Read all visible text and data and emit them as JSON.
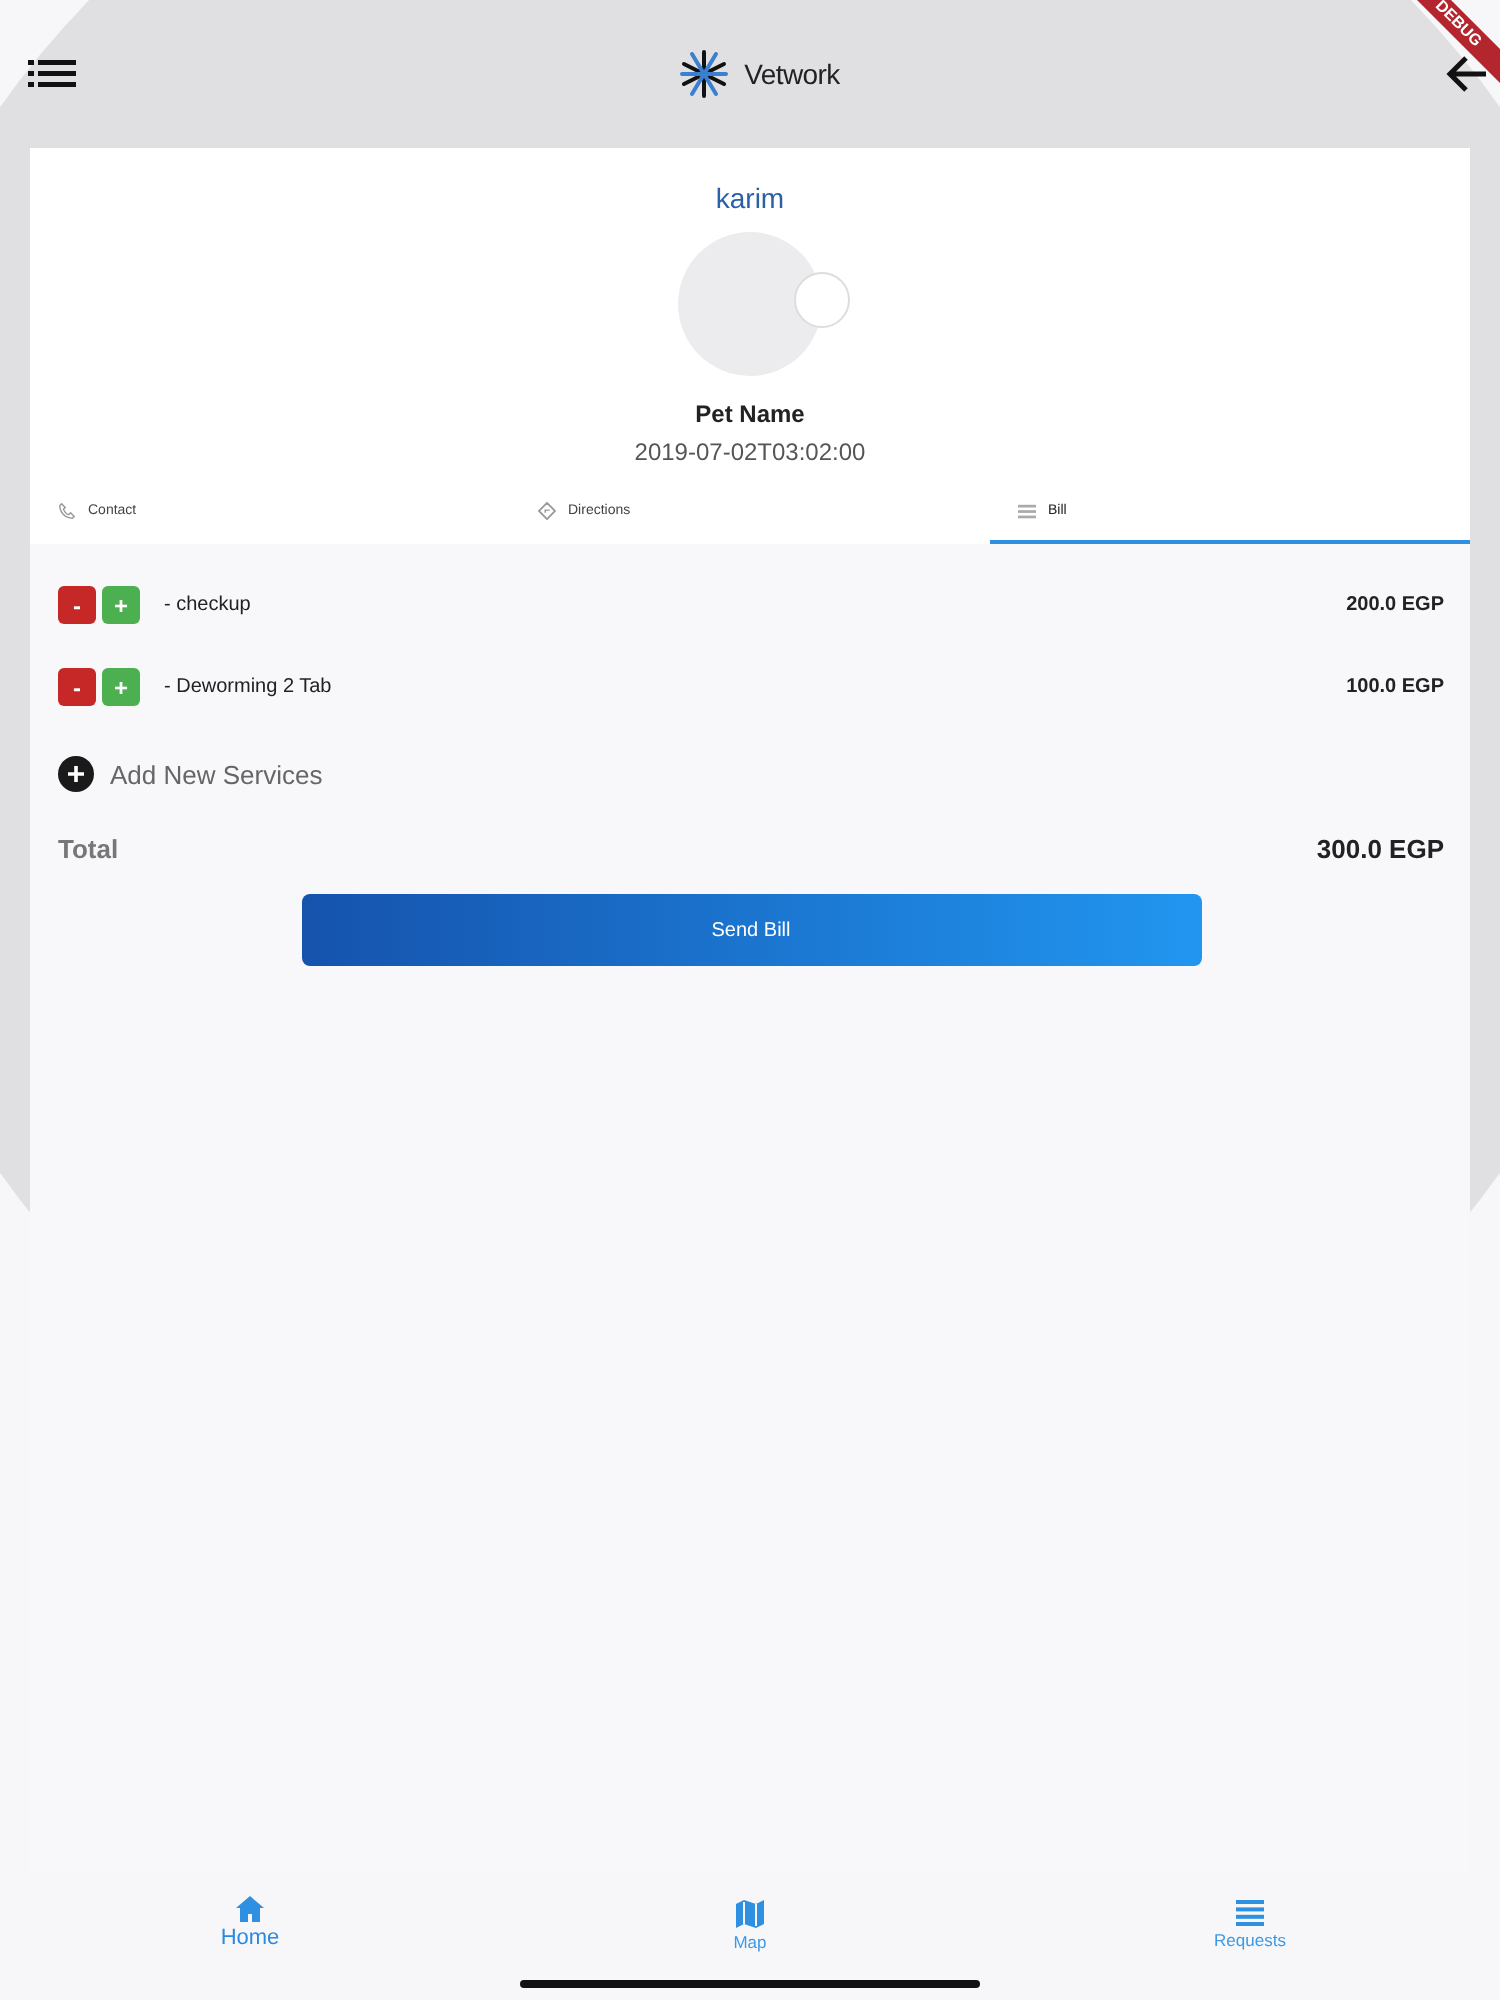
{
  "app_bar": {
    "title": "Vetwork"
  },
  "debug_banner": "DEBUG",
  "profile": {
    "owner": "karim",
    "pet_name": "Pet Name",
    "date": "2019-07-02T03:02:00"
  },
  "tabs": [
    {
      "label": "Contact",
      "kind": "phone",
      "selected": false
    },
    {
      "label": "Directions",
      "kind": "directions",
      "selected": false
    },
    {
      "label": "Bill",
      "kind": "list",
      "selected": true
    }
  ],
  "bill": {
    "items": [
      {
        "name": "- checkup",
        "price": "200.0 EGP"
      },
      {
        "name": "- Deworming 2 Tab",
        "price": "100.0 EGP"
      }
    ],
    "remove_label": "-",
    "add_label": "+",
    "add_service": "Add New Services",
    "total_label": "Total",
    "total": "300.0 EGP",
    "send_button": "Send Bill"
  },
  "bottom_nav": [
    {
      "label": "Home",
      "kind": "home",
      "selected": true
    },
    {
      "label": "Map",
      "kind": "map",
      "selected": false
    },
    {
      "label": "Requests",
      "kind": "list",
      "selected": false
    }
  ]
}
